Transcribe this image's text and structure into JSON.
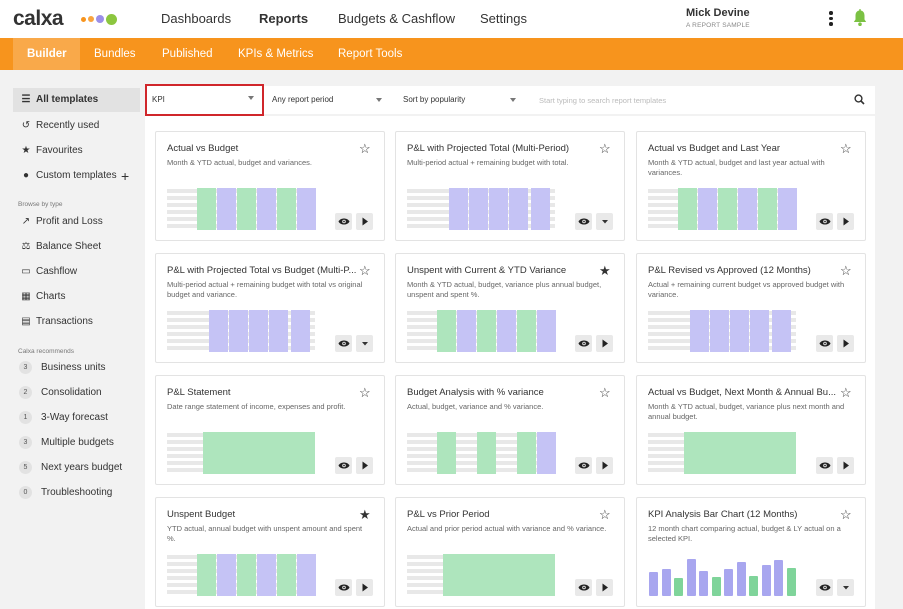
{
  "app": {
    "logo": "calxa",
    "logo_dot_colors": [
      "#f7941d",
      "#8cc63f",
      "#9b8fe8",
      "#4caf50"
    ]
  },
  "nav": {
    "items": [
      "Dashboards",
      "Reports",
      "Budgets & Cashflow",
      "Settings"
    ],
    "active": "Reports"
  },
  "user": {
    "name": "Mick Devine",
    "company": "A REPORT SAMPLE"
  },
  "subnav": {
    "items": [
      "Builder",
      "Bundles",
      "Published",
      "KPIs & Metrics",
      "Report Tools"
    ],
    "active": "Builder"
  },
  "sidebar": {
    "items": [
      {
        "label": "All templates",
        "icon": "list-icon"
      },
      {
        "label": "Recently used",
        "icon": "history-icon"
      },
      {
        "label": "Favourites",
        "icon": "star-icon"
      },
      {
        "label": "Custom templates",
        "icon": "palette-icon"
      }
    ],
    "browse_heading": "Browse by type",
    "types": [
      {
        "label": "Profit and Loss",
        "icon": "trend-icon"
      },
      {
        "label": "Balance Sheet",
        "icon": "scale-icon"
      },
      {
        "label": "Cashflow",
        "icon": "cashflow-icon"
      },
      {
        "label": "Charts",
        "icon": "chart-icon"
      },
      {
        "label": "Transactions",
        "icon": "transactions-icon"
      }
    ],
    "recommends_heading": "Calxa recommends",
    "recommends": [
      {
        "count": "3",
        "label": "Business units"
      },
      {
        "count": "2",
        "label": "Consolidation"
      },
      {
        "count": "1",
        "label": "3-Way forecast"
      },
      {
        "count": "3",
        "label": "Multiple budgets"
      },
      {
        "count": "5",
        "label": "Next years budget"
      },
      {
        "count": "0",
        "label": "Troubleshooting"
      }
    ]
  },
  "filters": {
    "kpi": "KPI",
    "period": "Any report period",
    "sort": "Sort by popularity",
    "search_placeholder": "Start typing to search report templates"
  },
  "colors": {
    "accent": "#f7941d",
    "green": "#aee5bd",
    "purple": "#c5c3f5",
    "highlight": "#d0262b"
  },
  "cards": [
    {
      "title": "Actual vs Budget",
      "desc": "Month & YTD actual, budget and variances.",
      "starred": false,
      "action": "play",
      "preview": "mixed6"
    },
    {
      "title": "P&L with Projected Total (Multi-Period)",
      "desc": "Multi-period actual + remaining budget with total.",
      "starred": false,
      "action": "dropdown",
      "preview": "purple5"
    },
    {
      "title": "Actual vs Budget and Last Year",
      "desc": "Month & YTD actual, budget and last year actual with variances.",
      "starred": false,
      "action": "play",
      "preview": "mixed6"
    },
    {
      "title": "P&L with Projected Total vs Budget (Multi-P...",
      "desc": "Multi-period actual + remaining budget with total vs original budget and variance.",
      "starred": false,
      "action": "dropdown",
      "preview": "purple5"
    },
    {
      "title": "Unspent with Current & YTD Variance",
      "desc": "Month & YTD actual, budget, variance plus annual budget, unspent and spent %.",
      "starred": true,
      "action": "play",
      "preview": "mixed6"
    },
    {
      "title": "P&L Revised vs Approved (12 Months)",
      "desc": "Actual + remaining current budget vs approved budget with variance.",
      "starred": false,
      "action": "play",
      "preview": "purple5"
    },
    {
      "title": "P&L Statement",
      "desc": "Date range statement of income, expenses and profit.",
      "starred": false,
      "action": "play",
      "preview": "greenblock"
    },
    {
      "title": "Budget Analysis with % variance",
      "desc": "Actual, budget, variance and % variance.",
      "starred": false,
      "action": "play",
      "preview": "green4"
    },
    {
      "title": "Actual vs Budget, Next Month & Annual Bu...",
      "desc": "Month & YTD actual, budget, variance plus next month and annual budget.",
      "starred": false,
      "action": "play",
      "preview": "greenblock"
    },
    {
      "title": "Unspent Budget",
      "desc": "YTD actual, annual budget with unspent amount and spent %.",
      "starred": true,
      "action": "play",
      "preview": "mixed6"
    },
    {
      "title": "P&L vs Prior Period",
      "desc": "Actual and prior period actual with variance and % variance.",
      "starred": false,
      "action": "play",
      "preview": "greenblock"
    },
    {
      "title": "KPI Analysis Bar Chart (12 Months)",
      "desc": "12 month chart comparing actual, budget & LY actual on a selected KPI.",
      "starred": false,
      "action": "dropdown",
      "preview": "barchart"
    }
  ],
  "chart_data": {
    "type": "bar",
    "values": [
      0.57,
      0.64,
      0.43,
      0.89,
      0.6,
      0.45,
      0.64,
      0.8,
      0.47,
      0.73,
      0.86,
      0.67
    ]
  }
}
